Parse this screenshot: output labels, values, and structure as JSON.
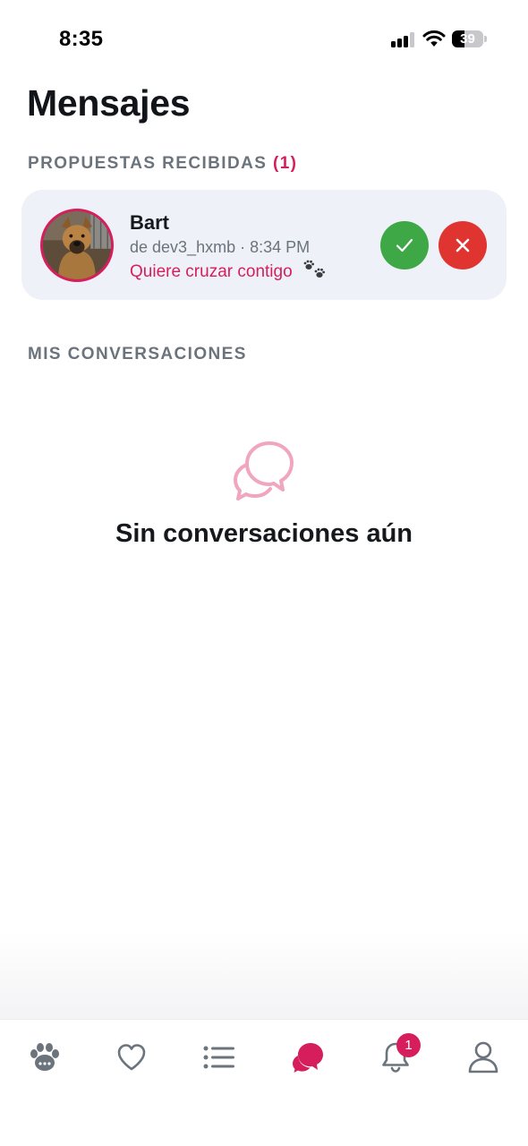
{
  "status_bar": {
    "time": "8:35",
    "battery": "39",
    "battery_level": 0.39
  },
  "page": {
    "title": "Mensajes"
  },
  "proposals": {
    "label": "PROPUESTAS RECIBIDAS",
    "count": "(1)",
    "items": [
      {
        "name": "Bart",
        "meta": "de dev3_hxmb · 8:34 PM",
        "message": "Quiere cruzar contigo",
        "avatar_icon": "dog-photo"
      }
    ]
  },
  "conversations": {
    "label": "MIS CONVERSACIONES",
    "empty_title": "Sin conversaciones aún",
    "empty_icon": "chat-bubbles-icon"
  },
  "tab_bar": {
    "tabs": [
      {
        "icon": "paw-icon"
      },
      {
        "icon": "heart-icon"
      },
      {
        "icon": "list-icon"
      },
      {
        "icon": "chat-icon",
        "active": true
      },
      {
        "icon": "bell-icon",
        "badge": "1"
      },
      {
        "icon": "user-icon"
      }
    ]
  },
  "colors": {
    "accent": "#d61e5d",
    "accept": "#3ea746",
    "reject": "#e03431",
    "card_bg": "#eef1f8",
    "muted_text": "#6b737c",
    "tab_icon": "#6b737c"
  }
}
